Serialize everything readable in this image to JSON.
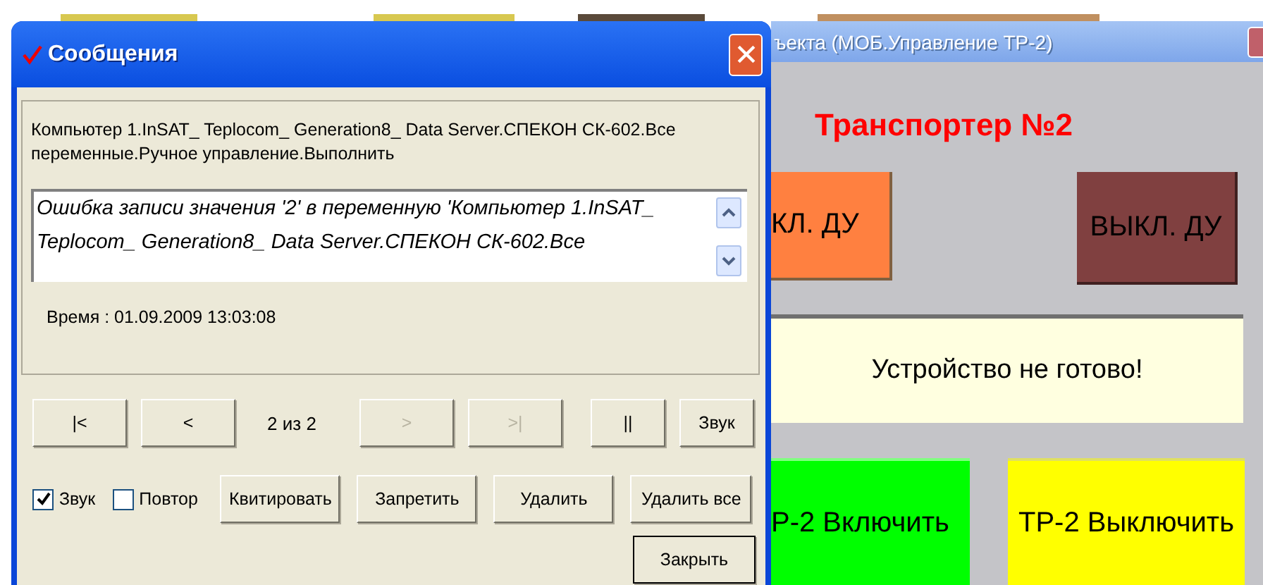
{
  "background_window": {
    "title": "ъекта (МОБ.Управление ТР-2)",
    "heading": "Транспортер №2",
    "mode_buttons": [
      {
        "label": "КЛ. ДУ",
        "color": "#ff8040"
      },
      {
        "label": "ВЫКЛ. ДУ",
        "color": "#804040"
      }
    ],
    "status": "Устройство не готово!",
    "action_buttons": [
      {
        "label": "Р-2 Включить",
        "color": "#00ff00"
      },
      {
        "label": "ТР-2 Выключить",
        "color": "#ffff00"
      }
    ]
  },
  "dialog": {
    "title": "Сообщения",
    "source": "Компьютер 1.InSAT_ Teplocom_ Generation8_ Data Server.СПЕКОН СК-602.Все\nпеременные.Ручное управление.Выполнить",
    "message": "Ошибка записи значения '2' в переменную 'Компьютер 1.InSAT_\nTeplocom_ Generation8_ Data Server.СПЕКОН СК-602.Все",
    "time": "Время : 01.09.2009 13:03:08",
    "nav_buttons": [
      {
        "label": "|<",
        "disabled": false
      },
      {
        "label": "<",
        "disabled": false
      },
      {
        "label": ">",
        "disabled": true
      },
      {
        "label": ">|",
        "disabled": true
      }
    ],
    "counter": "2 из  2",
    "pause_button": "||",
    "sound_button": "Звук",
    "checkboxes": [
      {
        "label": "Звук",
        "checked": true
      },
      {
        "label": "Повтор",
        "checked": false
      }
    ],
    "buttons": [
      "Квитировать",
      "Запретить",
      "Удалить",
      "Удалить все"
    ],
    "close_button": "Закрыть"
  }
}
